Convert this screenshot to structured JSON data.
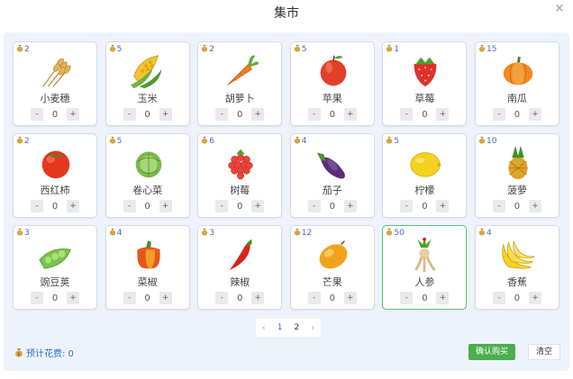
{
  "dialog": {
    "title": "集市"
  },
  "items": [
    {
      "name": "小麦穗",
      "price": "2",
      "qty": "0",
      "icon": "wheat-icon"
    },
    {
      "name": "玉米",
      "price": "5",
      "qty": "0",
      "icon": "corn-icon"
    },
    {
      "name": "胡萝卜",
      "price": "2",
      "qty": "0",
      "icon": "carrot-icon"
    },
    {
      "name": "苹果",
      "price": "5",
      "qty": "0",
      "icon": "apple-icon"
    },
    {
      "name": "草莓",
      "price": "1",
      "qty": "0",
      "icon": "strawberry-icon"
    },
    {
      "name": "南瓜",
      "price": "15",
      "qty": "0",
      "icon": "pumpkin-icon"
    },
    {
      "name": "西红柿",
      "price": "2",
      "qty": "0",
      "icon": "tomato-icon"
    },
    {
      "name": "卷心菜",
      "price": "5",
      "qty": "0",
      "icon": "cabbage-icon"
    },
    {
      "name": "树莓",
      "price": "6",
      "qty": "0",
      "icon": "raspberry-icon"
    },
    {
      "name": "茄子",
      "price": "4",
      "qty": "0",
      "icon": "eggplant-icon"
    },
    {
      "name": "柠檬",
      "price": "5",
      "qty": "0",
      "icon": "lemon-icon"
    },
    {
      "name": "菠萝",
      "price": "10",
      "qty": "0",
      "icon": "pineapple-icon"
    },
    {
      "name": "豌豆荚",
      "price": "3",
      "qty": "0",
      "icon": "peapod-icon"
    },
    {
      "name": "菜椒",
      "price": "4",
      "qty": "0",
      "icon": "bell-pepper-icon"
    },
    {
      "name": "辣椒",
      "price": "3",
      "qty": "0",
      "icon": "chili-icon"
    },
    {
      "name": "芒果",
      "price": "12",
      "qty": "0",
      "icon": "mango-icon"
    },
    {
      "name": "人参",
      "price": "50",
      "qty": "0",
      "icon": "ginseng-icon",
      "selected": true
    },
    {
      "name": "香蕉",
      "price": "4",
      "qty": "0",
      "icon": "banana-icon"
    }
  ],
  "controls": {
    "minus": "-",
    "plus": "+"
  },
  "pagination": {
    "prev": "‹",
    "next": "›",
    "pages": [
      "1",
      "2"
    ],
    "current": "1"
  },
  "footer": {
    "cost_label": "预计花费: 0",
    "buy_label": "确认购买",
    "clear_label": "清空"
  },
  "close_icon": "×",
  "colors": {
    "accent": "#3b6fd8",
    "buy": "#4cae4f",
    "panel": "#eef3fb",
    "selected_border": "#5cc46b"
  }
}
